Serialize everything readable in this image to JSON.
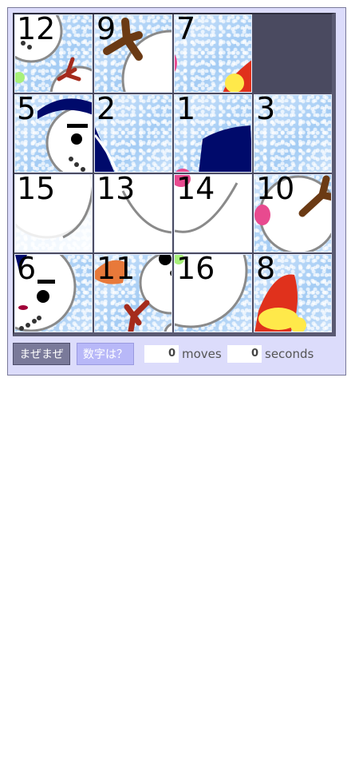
{
  "puzzle": {
    "tiles": [
      {
        "number": "12",
        "scene": "snow-left-top"
      },
      {
        "number": "9",
        "scene": "arm-brown"
      },
      {
        "number": "7",
        "scene": "hat-tip"
      },
      {
        "number": "",
        "scene": "empty"
      },
      {
        "number": "5",
        "scene": "face-left-hat"
      },
      {
        "number": "2",
        "scene": "hat-navy-left"
      },
      {
        "number": "1",
        "scene": "hat-navy"
      },
      {
        "number": "3",
        "scene": "plain"
      },
      {
        "number": "15",
        "scene": "body-white-left"
      },
      {
        "number": "13",
        "scene": "body-white-mid"
      },
      {
        "number": "14",
        "scene": "body-white-buttons"
      },
      {
        "number": "10",
        "scene": "body-arm-right"
      },
      {
        "number": "6",
        "scene": "face-bottom-left"
      },
      {
        "number": "11",
        "scene": "scarf-orange"
      },
      {
        "number": "16",
        "scene": "body-white-curve"
      },
      {
        "number": "8",
        "scene": "santa-hat"
      }
    ],
    "colors": {
      "hat_navy": "#000a6b",
      "arm_brown": "#6b3a14",
      "button_pink": "#e84a8f",
      "scarf_orange": "#e8793a",
      "santa_red": "#e0311c",
      "santa_yellow": "#ffe94a",
      "green_dot": "#a8f07a",
      "outline_gray": "#8a8a8a"
    }
  },
  "controls": {
    "shuffle_label": "まぜまぜ",
    "number_label": "数字は？",
    "moves_value": "0",
    "moves_unit": "moves",
    "seconds_value": "0",
    "seconds_unit": "seconds"
  }
}
